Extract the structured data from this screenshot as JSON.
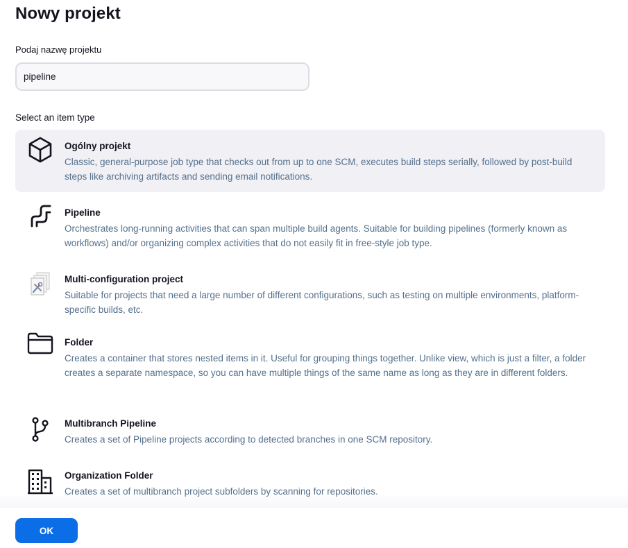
{
  "page": {
    "title": "Nowy projekt"
  },
  "name_field": {
    "label": "Podaj nazwę projektu",
    "value": "pipeline"
  },
  "item_types": {
    "label": "Select an item type",
    "items": [
      {
        "title": "Ogólny projekt",
        "description": "Classic, general-purpose job type that checks out from up to one SCM, executes build steps serially, followed by post-build steps like archiving artifacts and sending email notifications.",
        "icon": "freestyle-box-icon",
        "selected": true
      },
      {
        "title": "Pipeline",
        "description": "Orchestrates long-running activities that can span multiple build agents. Suitable for building pipelines (formerly known as workflows) and/or organizing complex activities that do not easily fit in free-style job type.",
        "icon": "pipeline-icon",
        "selected": false
      },
      {
        "title": "Multi-configuration project",
        "description": "Suitable for projects that need a large number of different configurations, such as testing on multiple environments, platform-specific builds, etc.",
        "icon": "multi-configuration-icon",
        "selected": false
      },
      {
        "title": "Folder",
        "description": "Creates a container that stores nested items in it. Useful for grouping things together. Unlike view, which is just a filter, a folder creates a separate namespace, so you can have multiple things of the same name as long as they are in different folders.",
        "icon": "folder-icon",
        "selected": false
      },
      {
        "title": "Multibranch Pipeline",
        "description": "Creates a set of Pipeline projects according to detected branches in one SCM repository.",
        "icon": "branch-icon",
        "selected": false
      },
      {
        "title": "Organization Folder",
        "description": "Creates a set of multibranch project subfolders by scanning for repositories.",
        "icon": "organization-building-icon",
        "selected": false
      }
    ]
  },
  "footer": {
    "ok_label": "OK"
  },
  "colors": {
    "accent": "#0b6ee6",
    "selected_background": "#f0f0f5",
    "description_text": "#54708c"
  }
}
